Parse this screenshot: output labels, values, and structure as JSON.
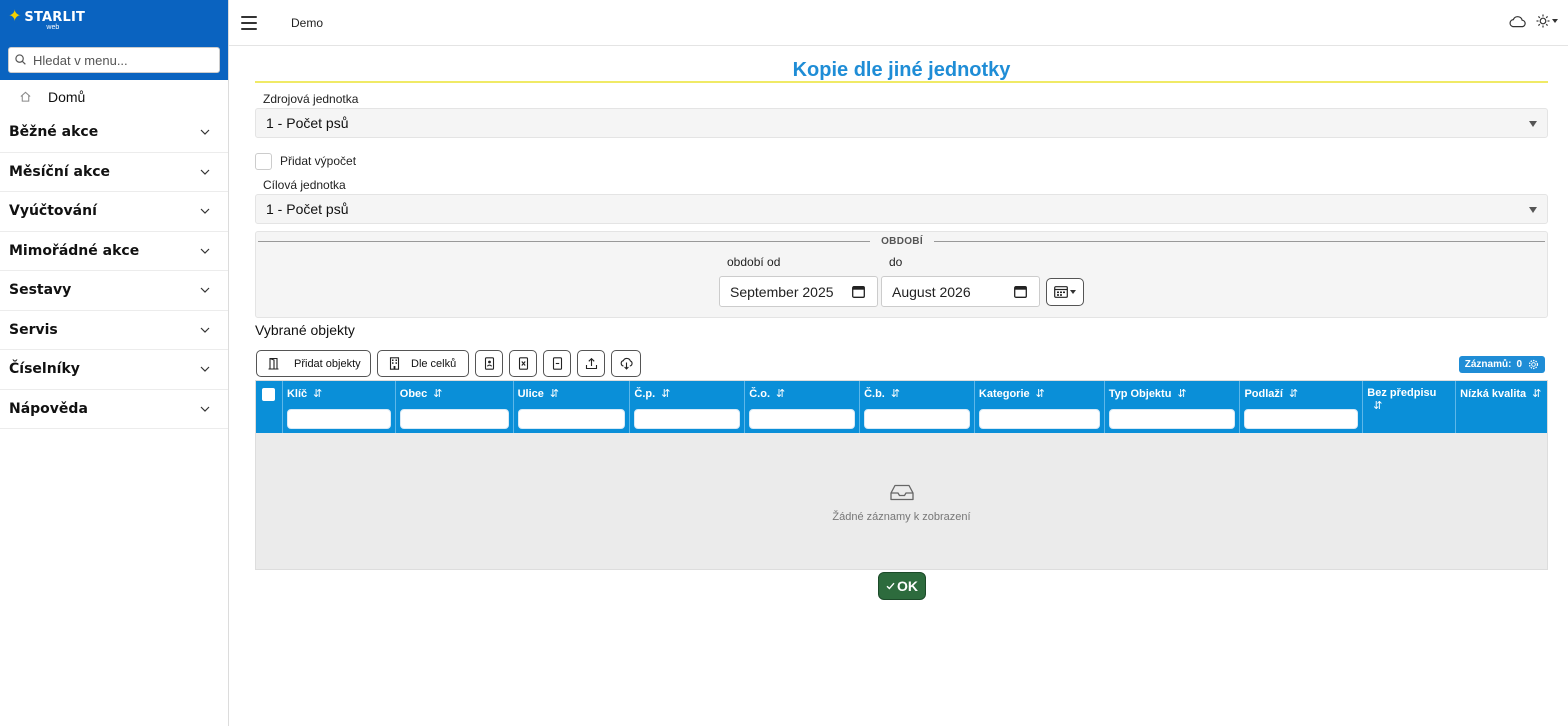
{
  "brand": {
    "name": "STARLIT",
    "sub": "web"
  },
  "sidebar": {
    "search_placeholder": "Hledat v menu...",
    "home_label": "Domů",
    "items": [
      {
        "label": "Běžné akce"
      },
      {
        "label": "Měsíční akce"
      },
      {
        "label": "Vyúčtování"
      },
      {
        "label": "Mimořádné akce"
      },
      {
        "label": "Sestavy"
      },
      {
        "label": "Servis"
      },
      {
        "label": "Číselníky"
      },
      {
        "label": "Nápověda"
      }
    ]
  },
  "topbar": {
    "title": "Demo"
  },
  "page": {
    "title": "Kopie dle jiné jednotky"
  },
  "form": {
    "source_label": "Zdrojová jednotka",
    "source_value": "1 - Počet psů",
    "add_calc_label": "Přidat výpočet",
    "target_label": "Cílová jednotka",
    "target_value": "1 - Počet psů",
    "period": {
      "title": "OBDOBÍ",
      "from_label": "období od",
      "to_label": "do",
      "from_value": "September 2025",
      "to_value": "August 2026"
    }
  },
  "objects": {
    "title": "Vybrané objekty",
    "add_button": "Přidat objekty",
    "by_units_button": "Dle celků",
    "count_label": "Záznamů:",
    "count_value": "0",
    "columns": [
      "Klíč",
      "Obec",
      "Ulice",
      "Č.p.",
      "Č.o.",
      "Č.b.",
      "Kategorie",
      "Typ Objektu",
      "Podlaží",
      "Bez předpisu",
      "Nízká kvalita"
    ],
    "sort_glyph": "⇵",
    "empty_text": "Žádné záznamy k zobrazení"
  },
  "ok_button": "OK",
  "colors": {
    "brand": "#0a63c0",
    "accent": "#1f8dd6",
    "table_header": "#0a8fd8",
    "ok": "#2d6b3d",
    "title_underline": "#f0ea66"
  }
}
